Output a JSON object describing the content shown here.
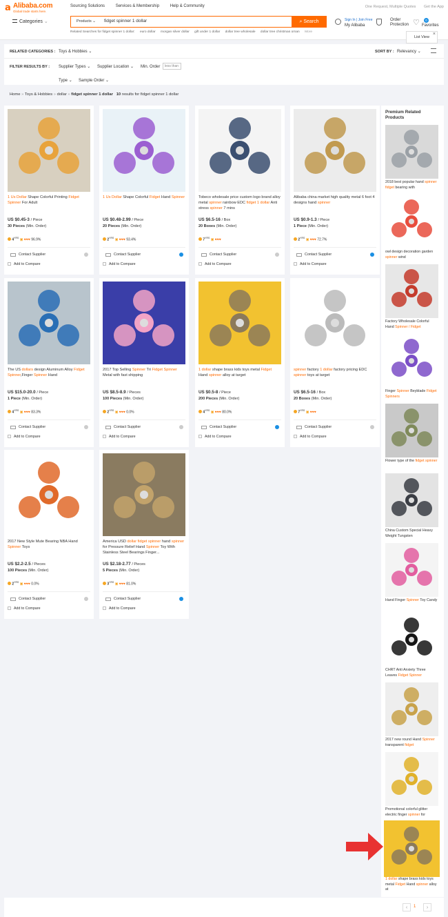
{
  "header": {
    "logo_name": "Alibaba.com",
    "logo_tagline": "Global trade starts here.",
    "nav": [
      "Sourcing Solutions",
      "Services & Membership",
      "Help & Community"
    ],
    "right_links": [
      "One Request, Multiple Quotes",
      "Get the App"
    ],
    "categories_label": "Categories",
    "search_scope": "Products",
    "search_value": "fidget spinner 1 dollar",
    "search_button": "Search",
    "related_prefix": "Related Searches for fidget spinner 1 dollar:",
    "related": [
      "euro dollar",
      "morgan silver dollar",
      "gift under 1 dollar",
      "dollar tree wholesale",
      "dollar tree christmas ornan"
    ],
    "related_more": "More",
    "sign_in": "Sign In",
    "join_free": "Join Free",
    "my_alibaba": "My Alibaba",
    "order_protection": "Order Protection",
    "favorites": "Favorites",
    "favorites_count": "0",
    "list_view": "List View"
  },
  "filters": {
    "related_categories_label": "RELATED CATEGORIES :",
    "related_category": "Toys & Hobbies",
    "sort_by_label": "SORT BY :",
    "sort_by_value": "Relevancy",
    "filter_label": "FILTER RESULTS BY :",
    "supplier_types": "Supplier Types",
    "supplier_location": "Supplier Location",
    "min_order_label": "Min. Order",
    "min_order_placeholder": "less than",
    "type": "Type",
    "sample_order": "Sample Order"
  },
  "breadcrumb": {
    "home": "Home",
    "toys": "Toys & Hobbies",
    "dollar": "dollar",
    "current": "fidget spinner 1 dollar",
    "count": "10",
    "results_text": "results for fidget spinner 1 dollar"
  },
  "common": {
    "contact_supplier": "Contact Supplier",
    "add_to_compare": "Add to Compare",
    "min_order_suffix": "(Min. Order)"
  },
  "products": [
    {
      "title_html": "<b>1 Us Dollar</b> Shape Colorful Printing <b>Fidget Spinner</b> For Adult",
      "price": "US $0.45-3",
      "unit": "/ Piece",
      "moq": "30 Pieces",
      "yrs": "4",
      "stats": "96.9%",
      "verified": false,
      "colors": [
        "#e8a33c",
        "#d8d0c0"
      ]
    },
    {
      "title_html": "<b>1 Us Dollar</b> Shape Colorful <b>Fidget</b> Hand <b>Spinner</b>",
      "price": "US $0.48-2.99",
      "unit": "/ Piece",
      "moq": "20 Pieces",
      "yrs": "2",
      "stats": "93.4%",
      "verified": true,
      "colors": [
        "#9b5fd1",
        "#e9f2f7"
      ]
    },
    {
      "title_html": "Tobeco wholesale price custom logo brand alloy metal <b>spinner</b> rainbow EDC <b>fidget 1 dollar</b> Anti stress <b>spinner</b> 7 mins",
      "price": "US $6.5-16",
      "unit": "/ Box",
      "moq": "20 Boxes",
      "yrs": "7",
      "stats": "",
      "verified": false,
      "colors": [
        "#3b4f70",
        "#f4f4f4"
      ]
    },
    {
      "title_html": "Alibaba china market high quality metal 6 foot 4 designs hand <b>spinner</b>",
      "price": "US $0.9-1.3",
      "unit": "/ Piece",
      "moq": "1 Piece",
      "yrs": "2",
      "stats": "72.7%",
      "verified": true,
      "colors": [
        "#c19a50",
        "#ececec"
      ]
    },
    {
      "title_html": "The US <b>dollars</b> design Aluminum Alloy <b>Fidget Spinner</b>,Finger <b>Spinner</b> Hand",
      "price": "US $15.0-20.0",
      "unit": "/ Piece",
      "moq": "1 Piece",
      "yrs": "4",
      "stats": "83.3%",
      "verified": false,
      "colors": [
        "#2a6fb5",
        "#b8c4cc"
      ]
    },
    {
      "title_html": "2017 Top Selling <b>Spinner</b> Tri <b>Fidget Spinner</b> Metal with fast shipping",
      "price": "US $8.5-8.9",
      "unit": "/ Pieces",
      "moq": "100 Pieces",
      "yrs": "2",
      "stats": "0.0%",
      "verified": false,
      "colors": [
        "#f2a3c6",
        "#3a3ea8"
      ]
    },
    {
      "title_html": "<b>1 dollar</b> shape brass kids toys metal <b>Fidget</b> Hand <b>spinner</b> alloy at target",
      "price": "US $0.5-8",
      "unit": "/ Piece",
      "moq": "200 Pieces",
      "yrs": "4",
      "stats": "80.0%",
      "verified": true,
      "colors": [
        "#8c7a5a",
        "#f2c230"
      ]
    },
    {
      "title_html": "<b>spinner</b> factory <b>1 dollar</b> factory pricing EDC <b>spinner</b> toys at target",
      "price": "US $6.5-16",
      "unit": "/ Box",
      "moq": "20 Boxes",
      "yrs": "7",
      "stats": "",
      "verified": false,
      "colors": [
        "#bbbbbb",
        "#ffffff"
      ]
    },
    {
      "title_html": "2017 New Style Mute Bearing NBA Hand <b>Spinner</b> Toys",
      "price": "US $2.2-2.5",
      "unit": "/ Pieces",
      "moq": "100 Pieces",
      "yrs": "2",
      "stats": "0.0%",
      "verified": false,
      "colors": [
        "#e06a2a",
        "#ffffff"
      ]
    },
    {
      "title_html": "America USD <b>dollar fidget spinner</b> hand <b>spinner</b> for Pressure Relief Hand <b>Spinner</b> Toy With Stainless Steel Bearings Finger...",
      "price": "US $2.18-2.77",
      "unit": "/ Pieces",
      "moq": "5 Pieces",
      "yrs": "3",
      "stats": "81.0%",
      "verified": true,
      "colors": [
        "#c2a36b",
        "#8a7b60"
      ]
    }
  ],
  "premium": {
    "heading": "Premium Related Products",
    "items": [
      {
        "title_html": "2018 best popular hand <b>spinner fidget</b> bearing with",
        "colors": [
          "#9aa0a6",
          "#d9d9d9"
        ]
      },
      {
        "title_html": "owl design decoration garden <b>spinner</b> wind",
        "colors": [
          "#e84d3d",
          "#ffffff"
        ]
      },
      {
        "title_html": "Factory Wholesale Colorful Hand <b>Spinner / Fidget</b>",
        "colors": [
          "#c43b2c",
          "#e7e7e7"
        ]
      },
      {
        "title_html": "Finger <b>Spinner</b> Beyblade <b>Fidget Spinners</b>",
        "colors": [
          "#7b4ec7",
          "#ffffff"
        ]
      },
      {
        "title_html": "Flower type of the <b>fidget spinner</b>",
        "colors": [
          "#7f8a5a",
          "#c9c9c9"
        ]
      },
      {
        "title_html": "China Custom Special Heavy Weight Tungsten",
        "colors": [
          "#3a3d44",
          "#e3e3e3"
        ]
      },
      {
        "title_html": "Hand Finger <b>Spinner</b> Toy Candy",
        "colors": [
          "#e25d9f",
          "#f4f4f4"
        ]
      },
      {
        "title_html": "CHRT Anti Anxiety Three Leaves <b>Fidget Spinner</b>",
        "colors": [
          "#151515",
          "#ffffff"
        ]
      },
      {
        "title_html": "2017 new round Hand <b>Spinner</b> transparent <b>fidget</b>",
        "colors": [
          "#c8a24a",
          "#eeeeee"
        ]
      },
      {
        "title_html": "Promotional colorful glitter electric finger <b>spinner</b> for",
        "colors": [
          "#e0b12a",
          "#f5f5f5"
        ]
      },
      {
        "title_html": "<b>1 dollar</b> shape brass kids toys metal <b>Fidget</b> Hand <b>spinner</b> alloy at",
        "colors": [
          "#8c7a5a",
          "#f2c230"
        ]
      }
    ]
  },
  "pager": {
    "page": "1"
  }
}
